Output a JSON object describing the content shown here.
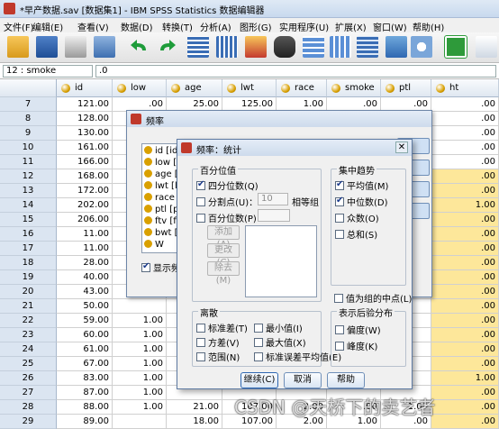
{
  "window": {
    "title": "*早产数据.sav [数据集1] - IBM SPSS Statistics 数据编辑器"
  },
  "menu": [
    "文件(F)",
    "编辑(E)",
    "查看(V)",
    "数据(D)",
    "转换(T)",
    "分析(A)",
    "图形(G)",
    "实用程序(U)",
    "扩展(X)",
    "窗口(W)",
    "帮助(H)"
  ],
  "toolbar": {
    "icons": [
      "open-folder-icon",
      "save-icon",
      "print-icon",
      "recall-dialog-icon",
      "undo-icon",
      "redo-icon",
      "goto-case-icon",
      "goto-variable-icon",
      "variables-icon",
      "find-icon",
      "insert-cases-icon",
      "insert-variable-icon",
      "split-file-icon",
      "weight-cases-icon",
      "value-labels-icon",
      "use-sets-icon",
      "extension-icon"
    ],
    "colors": {
      "accent": "#2e67b1",
      "highlight": "#fde79a"
    }
  },
  "cellbar": {
    "ref": "12 : smoke",
    "value": ".0"
  },
  "grid": {
    "columns": [
      "id",
      "low",
      "age",
      "lwt",
      "race",
      "smoke",
      "ptl",
      "ht"
    ],
    "rows": [
      {
        "n": "7",
        "cells": [
          "121.00",
          ".00",
          "25.00",
          "125.00",
          "1.00",
          ".00",
          ".00",
          ".00"
        ]
      },
      {
        "n": "8",
        "cells": [
          "128.00",
          "",
          "",
          "",
          "",
          "",
          "",
          ".00"
        ]
      },
      {
        "n": "9",
        "cells": [
          "130.00",
          "",
          "",
          "",
          "",
          "",
          "",
          ".00"
        ]
      },
      {
        "n": "10",
        "cells": [
          "161.00",
          "",
          "",
          "",
          "",
          "",
          "",
          ".00"
        ]
      },
      {
        "n": "11",
        "cells": [
          "166.00",
          "",
          "",
          "",
          "",
          "",
          "",
          ".00"
        ]
      },
      {
        "n": "12",
        "cells": [
          "168.00",
          "",
          "",
          "",
          "",
          "",
          "",
          ".00"
        ]
      },
      {
        "n": "13",
        "cells": [
          "172.00",
          "",
          "",
          "",
          "",
          "",
          "",
          ".00"
        ]
      },
      {
        "n": "14",
        "cells": [
          "202.00",
          "",
          "",
          "",
          "",
          "",
          "",
          "1.00"
        ]
      },
      {
        "n": "15",
        "cells": [
          "206.00",
          "",
          "",
          "",
          "",
          "",
          "",
          ".00"
        ]
      },
      {
        "n": "16",
        "cells": [
          "11.00",
          "",
          "",
          "",
          "",
          "",
          "",
          ".00"
        ]
      },
      {
        "n": "17",
        "cells": [
          "11.00",
          "",
          "",
          "",
          "",
          "",
          "",
          ".00"
        ]
      },
      {
        "n": "18",
        "cells": [
          "28.00",
          "",
          "",
          "",
          "",
          "",
          "",
          ".00"
        ]
      },
      {
        "n": "19",
        "cells": [
          "40.00",
          "",
          "",
          "",
          "",
          "",
          "",
          ".00"
        ]
      },
      {
        "n": "20",
        "cells": [
          "43.00",
          "",
          "",
          "",
          "",
          "",
          "",
          ".00"
        ]
      },
      {
        "n": "21",
        "cells": [
          "50.00",
          "",
          "",
          "",
          "",
          "",
          "",
          ".00"
        ]
      },
      {
        "n": "22",
        "cells": [
          "59.00",
          "1.00",
          "",
          "",
          "",
          "",
          "",
          ".00"
        ]
      },
      {
        "n": "23",
        "cells": [
          "60.00",
          "1.00",
          "",
          "",
          "",
          "",
          "",
          ".00"
        ]
      },
      {
        "n": "24",
        "cells": [
          "61.00",
          "1.00",
          "",
          "",
          "",
          "",
          "",
          ".00"
        ]
      },
      {
        "n": "25",
        "cells": [
          "67.00",
          "1.00",
          "",
          "",
          "",
          "",
          "",
          ".00"
        ]
      },
      {
        "n": "26",
        "cells": [
          "83.00",
          "1.00",
          "",
          "",
          "",
          "",
          "",
          "1.00"
        ]
      },
      {
        "n": "27",
        "cells": [
          "87.00",
          "1.00",
          "",
          "",
          "",
          "",
          "",
          ".00"
        ]
      },
      {
        "n": "28",
        "cells": [
          "88.00",
          "1.00",
          "21.00",
          "107.00",
          "2.00",
          ".00",
          "1.00",
          ".00"
        ]
      },
      {
        "n": "29",
        "cells": [
          "89.00",
          "",
          "18.00",
          "107.00",
          "2.00",
          "1.00",
          ".00",
          ".00"
        ]
      }
    ]
  },
  "freq_dialog": {
    "title": "频率",
    "vars": [
      "id [id]",
      "low [lo",
      "age [a",
      "lwt [lw",
      "race [",
      "ptl [pt",
      "ftv [ft",
      "bwt [",
      "W"
    ],
    "show_tables": "显示频"
  },
  "stats_dialog": {
    "title": "频率：统计",
    "percentile": {
      "group": "百分位值",
      "quartiles": "四分位数(Q)",
      "cut_points": "分割点(U)：",
      "cut_points_value": "10",
      "equal_groups": "相等组",
      "percentiles": "百分位数(P)：",
      "add": "添加(A)",
      "change": "更改(C)",
      "remove": "除去(M)"
    },
    "central": {
      "group": "集中趋势",
      "mean": "平均值(M)",
      "median": "中位数(D)",
      "mode": "众数(O)",
      "sum": "总和(S)"
    },
    "midpoints": "值为组的中点(L)",
    "dispersion": {
      "group": "离散",
      "std": "标准差(T)",
      "min": "最小值(I)",
      "var": "方差(V)",
      "max": "最大值(X)",
      "range": "范围(N)",
      "se": "标准误差平均值(E)"
    },
    "distribution": {
      "group": "表示后验分布",
      "skew": "偏度(W)",
      "kurt": "峰度(K)"
    },
    "buttons": {
      "continue": "继续(C)",
      "cancel": "取消",
      "help": "帮助"
    }
  },
  "watermark": "CSDN @天桥下的卖艺者"
}
